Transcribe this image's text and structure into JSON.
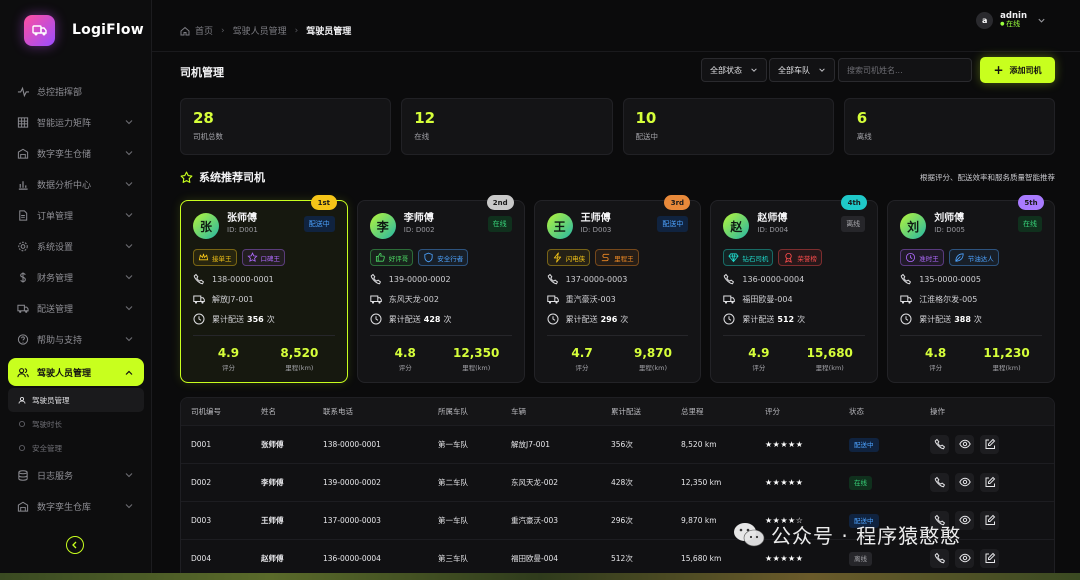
{
  "brand": {
    "name": "LogiFlow",
    "accent": "#c8ff1e"
  },
  "sidebar": {
    "items": [
      {
        "label": "总控指挥部",
        "icon": "activity-icon",
        "chevron": false
      },
      {
        "label": "智能运力矩阵",
        "icon": "grid-icon",
        "chevron": true
      },
      {
        "label": "数字孪生仓储",
        "icon": "warehouse-icon",
        "chevron": true
      },
      {
        "label": "数据分析中心",
        "icon": "bar-chart-icon",
        "chevron": true
      },
      {
        "label": "订单管理",
        "icon": "file-icon",
        "chevron": true
      },
      {
        "label": "系统设置",
        "icon": "gear-icon",
        "chevron": true
      },
      {
        "label": "财务管理",
        "icon": "dollar-icon",
        "chevron": true
      },
      {
        "label": "配送管理",
        "icon": "truck-icon",
        "chevron": true
      },
      {
        "label": "帮助与支持",
        "icon": "help-icon",
        "chevron": true
      }
    ],
    "active_item": {
      "label": "驾驶人员管理",
      "icon": "users-icon"
    },
    "sub_items": [
      {
        "label": "驾驶员管理",
        "active": true
      },
      {
        "label": "驾驶时长",
        "active": false
      },
      {
        "label": "安全管理",
        "active": false
      }
    ],
    "after_items": [
      {
        "label": "日志服务",
        "icon": "database-icon"
      },
      {
        "label": "数字孪生仓库",
        "icon": "warehouse-icon"
      }
    ]
  },
  "header": {
    "breadcrumb": [
      "首页",
      "驾驶人员管理",
      "驾驶员管理"
    ],
    "user": {
      "initial": "a",
      "name": "adnin",
      "status": "在线"
    }
  },
  "page": {
    "title": "司机管理",
    "filter_status": "全部状态",
    "filter_team": "全部车队",
    "search_placeholder": "搜索司机姓名...",
    "add_label": "添加司机"
  },
  "stats": [
    {
      "value": "28",
      "label": "司机总数"
    },
    {
      "value": "12",
      "label": "在线"
    },
    {
      "value": "10",
      "label": "配送中"
    },
    {
      "value": "6",
      "label": "离线"
    }
  ],
  "recommend": {
    "title": "系统推荐司机",
    "note": "根据评分、配送效率和服务质量智能推荐"
  },
  "cards": [
    {
      "rank": "1st",
      "rank_color": "#f5c518",
      "initial": "张",
      "name": "张师傅",
      "id": "ID: D001",
      "status": "配送中",
      "status_type": "delivery",
      "tags": [
        {
          "label": "接单王",
          "icon": "crown",
          "color": "#f5c518"
        },
        {
          "label": "口碑王",
          "icon": "star",
          "color": "#b06bff"
        }
      ],
      "phone": "138-0000-0001",
      "vehicle": "解放J7-001",
      "deliveries_prefix": "累计配送",
      "deliveries": "356",
      "deliveries_suffix": "次",
      "rating": "4.9",
      "rating_label": "评分",
      "mileage": "8,520",
      "mileage_label": "里程(km)"
    },
    {
      "rank": "2nd",
      "rank_color": "#c9c9c9",
      "initial": "李",
      "name": "李师傅",
      "id": "ID: D002",
      "status": "在线",
      "status_type": "online",
      "tags": [
        {
          "label": "好评哥",
          "icon": "thumb",
          "color": "#4cd964"
        },
        {
          "label": "安全行者",
          "icon": "shield",
          "color": "#4da3ff"
        }
      ],
      "phone": "139-0000-0002",
      "vehicle": "东风天龙-002",
      "deliveries_prefix": "累计配送",
      "deliveries": "428",
      "deliveries_suffix": "次",
      "rating": "4.8",
      "rating_label": "评分",
      "mileage": "12,350",
      "mileage_label": "里程(km)"
    },
    {
      "rank": "3rd",
      "rank_color": "#e8893a",
      "initial": "王",
      "name": "王师傅",
      "id": "ID: D003",
      "status": "配送中",
      "status_type": "delivery",
      "tags": [
        {
          "label": "闪电侠",
          "icon": "bolt",
          "color": "#f5c518"
        },
        {
          "label": "里程王",
          "icon": "route",
          "color": "#f08a24"
        }
      ],
      "phone": "137-0000-0003",
      "vehicle": "重汽豪沃-003",
      "deliveries_prefix": "累计配送",
      "deliveries": "296",
      "deliveries_suffix": "次",
      "rating": "4.7",
      "rating_label": "评分",
      "mileage": "9,870",
      "mileage_label": "里程(km)"
    },
    {
      "rank": "4th",
      "rank_color": "#1fc8c8",
      "initial": "赵",
      "name": "赵师傅",
      "id": "ID: D004",
      "status": "离线",
      "status_type": "offline",
      "tags": [
        {
          "label": "钻石司机",
          "icon": "diamond",
          "color": "#1fd6c8"
        },
        {
          "label": "荣誉榜",
          "icon": "medal",
          "color": "#ff4d4d"
        }
      ],
      "phone": "136-0000-0004",
      "vehicle": "福田欧曼-004",
      "deliveries_prefix": "累计配送",
      "deliveries": "512",
      "deliveries_suffix": "次",
      "rating": "4.9",
      "rating_label": "评分",
      "mileage": "15,680",
      "mileage_label": "里程(km)"
    },
    {
      "rank": "5th",
      "rank_color": "#a97bff",
      "initial": "刘",
      "name": "刘师傅",
      "id": "ID: D005",
      "status": "在线",
      "status_type": "online",
      "tags": [
        {
          "label": "准时王",
          "icon": "clock",
          "color": "#b06bff"
        },
        {
          "label": "节油达人",
          "icon": "leaf",
          "color": "#4da3ff"
        }
      ],
      "phone": "135-0000-0005",
      "vehicle": "江淮格尔发-005",
      "deliveries_prefix": "累计配送",
      "deliveries": "388",
      "deliveries_suffix": "次",
      "rating": "4.8",
      "rating_label": "评分",
      "mileage": "11,230",
      "mileage_label": "里程(km)"
    }
  ],
  "table": {
    "headers": [
      "司机编号",
      "姓名",
      "联系电话",
      "所属车队",
      "车辆",
      "累计配送",
      "总里程",
      "评分",
      "状态",
      "操作"
    ],
    "rows": [
      {
        "id": "D001",
        "name": "张师傅",
        "phone": "138-0000-0001",
        "team": "第一车队",
        "vehicle": "解放J7-001",
        "deliveries": "356次",
        "mileage": "8,520 km",
        "stars": "★★★★★",
        "status": "配送中",
        "status_type": "delivery"
      },
      {
        "id": "D002",
        "name": "李师傅",
        "phone": "139-0000-0002",
        "team": "第二车队",
        "vehicle": "东风天龙-002",
        "deliveries": "428次",
        "mileage": "12,350 km",
        "stars": "★★★★★",
        "status": "在线",
        "status_type": "online"
      },
      {
        "id": "D003",
        "name": "王师傅",
        "phone": "137-0000-0003",
        "team": "第一车队",
        "vehicle": "重汽豪沃-003",
        "deliveries": "296次",
        "mileage": "9,870 km",
        "stars": "★★★★☆",
        "status": "配送中",
        "status_type": "delivery"
      },
      {
        "id": "D004",
        "name": "赵师傅",
        "phone": "136-0000-0004",
        "team": "第三车队",
        "vehicle": "福田欧曼-004",
        "deliveries": "512次",
        "mileage": "15,680 km",
        "stars": "★★★★★",
        "status": "离线",
        "status_type": "offline"
      }
    ]
  },
  "watermark": {
    "text": "公众号 · 程序猿憨憨"
  }
}
